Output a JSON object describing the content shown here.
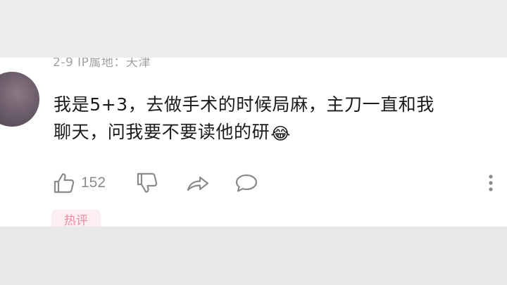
{
  "comment": {
    "meta_text": "2-9  IP属地：天津",
    "text_line1": "我是5+3，去做手术的时候局麻，主刀一直和我",
    "text_line2": "聊天，问我要不要读他的研",
    "emoji": "😂",
    "like_count": "152",
    "badge": "热评"
  },
  "icons": {
    "like": "thumbs-up-icon",
    "dislike": "thumbs-down-icon",
    "share": "share-arrow-icon",
    "reply": "comment-bubble-icon",
    "more": "more-vertical-icon"
  },
  "colors": {
    "meta_gray": "#a2a2a2",
    "text_dark": "#1b1b1b",
    "icon_gray": "#8a8a8a",
    "badge_bg": "#fdeef2",
    "badge_text": "#f08aa2"
  }
}
